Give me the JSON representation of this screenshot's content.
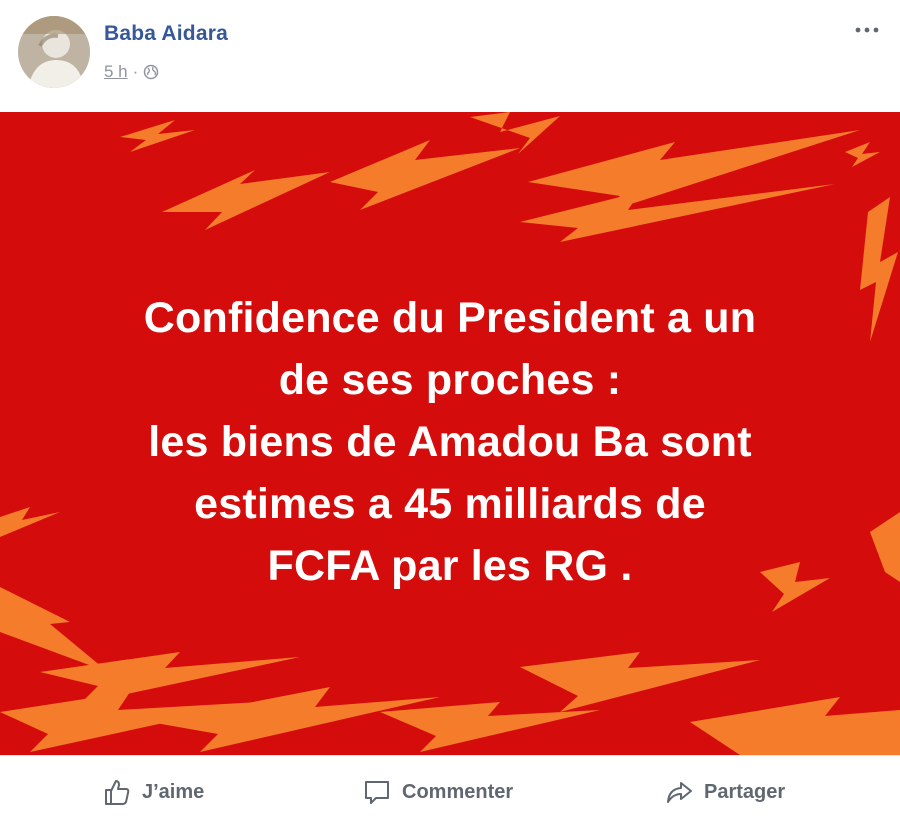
{
  "post": {
    "author": "Baba Aidara",
    "time": "5 h",
    "separator": "·",
    "privacy_icon": "globe-icon",
    "more_icon": "more-options-icon",
    "image": {
      "background_color": "#d40c0c",
      "bolt_color": "#f57c2a",
      "headline_lines": [
        "Confidence du President a un",
        "de ses proches :",
        "les biens de Amadou Ba sont",
        "estimes a 45 milliards de",
        "FCFA par les RG ."
      ]
    },
    "actions": {
      "like_label": "J’aime",
      "comment_label": "Commenter",
      "share_label": "Partager"
    }
  }
}
